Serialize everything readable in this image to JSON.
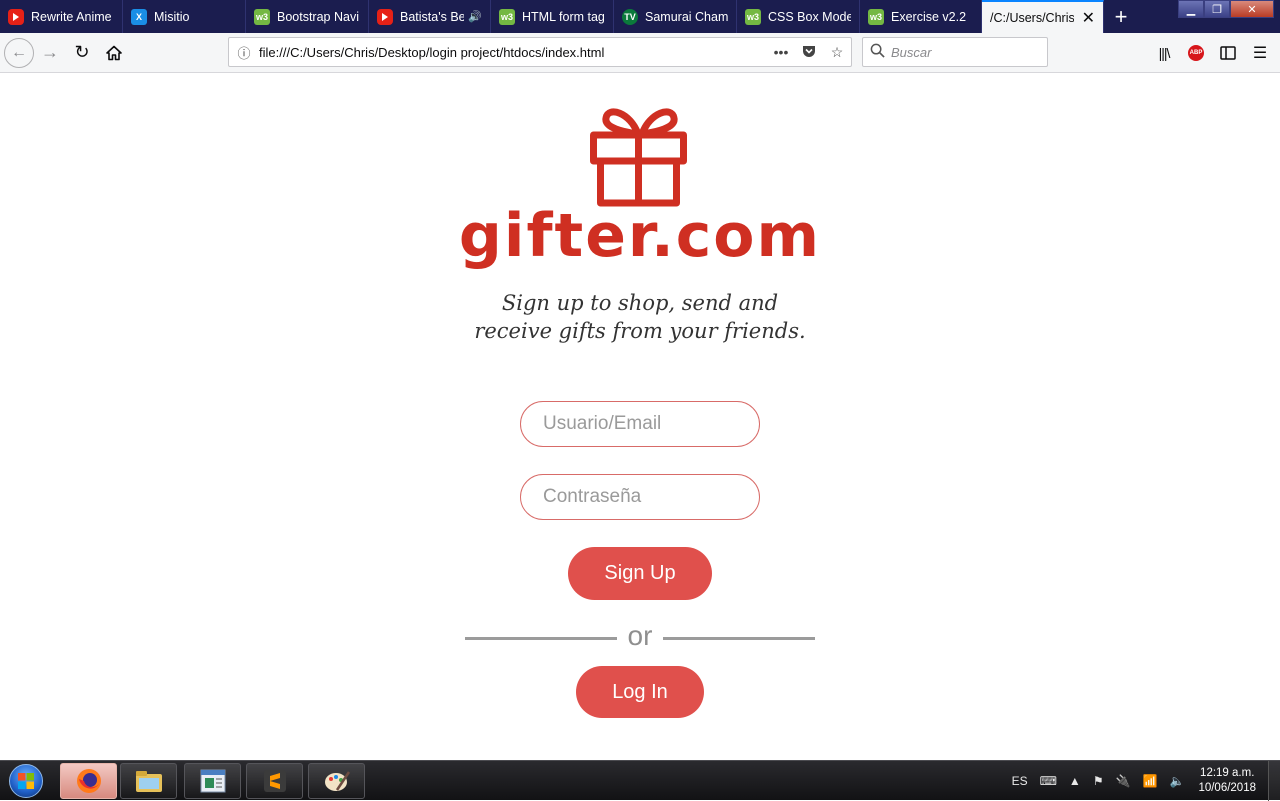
{
  "browser": {
    "tabs": [
      {
        "label": "Rewrite Anime",
        "favicon": "youtube-icon"
      },
      {
        "label": "Misitio",
        "favicon": "x-icon"
      },
      {
        "label": "Bootstrap Navi",
        "favicon": "w3schools-icon"
      },
      {
        "label": "Batista's Be",
        "favicon": "youtube-icon",
        "audio": true
      },
      {
        "label": "HTML form tag",
        "favicon": "w3schools-icon"
      },
      {
        "label": "Samurai Champ",
        "favicon": "tv-icon"
      },
      {
        "label": "CSS Box Model",
        "favicon": "w3schools-icon"
      },
      {
        "label": "Exercise v2.2",
        "favicon": "w3schools-icon"
      },
      {
        "label": "/C:/Users/Chris/",
        "active": true
      }
    ],
    "url": "file:///C:/Users/Chris/Desktop/login project/htdocs/index.html",
    "search_placeholder": "Buscar",
    "accent_color": "#0a84ff",
    "tabstrip_color": "#1b1d4f"
  },
  "page": {
    "logo_text": "gifter.com",
    "brand_color": "#cf2f22",
    "tagline_line1": "Sign up to shop, send and",
    "tagline_line2": "receive gifts from your friends.",
    "username_placeholder": "Usuario/Email",
    "password_placeholder": "Contraseña",
    "signup_label": "Sign Up",
    "or_label": "or",
    "login_label": "Log In",
    "button_color": "#e0504c"
  },
  "taskbar": {
    "apps": [
      "firefox-icon",
      "file-explorer-icon",
      "notepad-icon",
      "sublime-text-icon",
      "paint-icon"
    ],
    "language": "ES",
    "time": "12:19 a.m.",
    "date": "10/06/2018"
  }
}
